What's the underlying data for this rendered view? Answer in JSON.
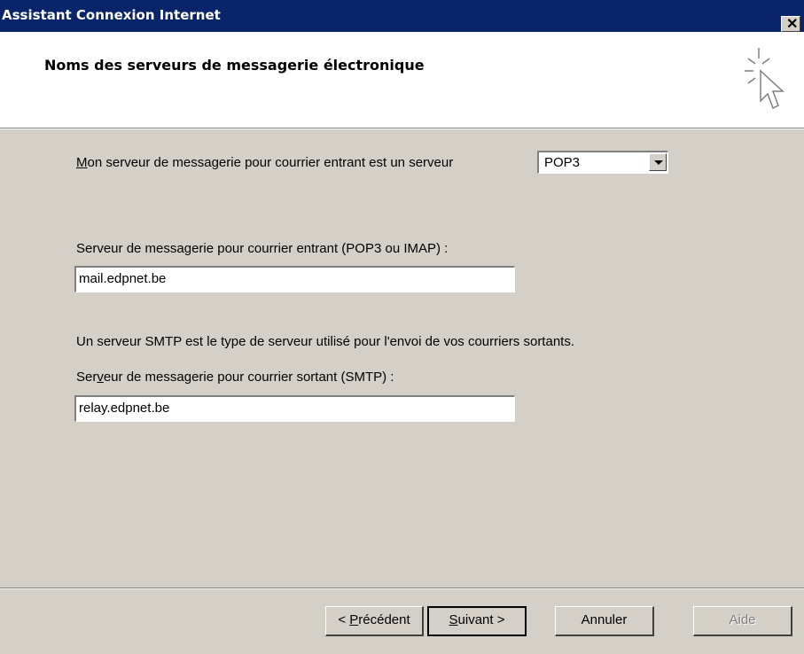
{
  "window": {
    "title": "Assistant Connexion Internet",
    "close": "✕"
  },
  "header": {
    "title": "Noms des serveurs de messagerie électronique"
  },
  "incoming_type": {
    "label_accel": "M",
    "label_rest": "on serveur de messagerie pour courrier entrant est un serveur",
    "selected": "POP3"
  },
  "incoming_server": {
    "label": "Serveur de messagerie pour courrier entrant (POP3 ou IMAP) :",
    "value": "mail.edpnet.be"
  },
  "smtp_info": "Un serveur SMTP est le type de serveur utilisé pour l'envoi de vos courriers sortants.",
  "outgoing_server": {
    "label_pre": "Ser",
    "label_accel": "v",
    "label_post": "eur de messagerie pour courrier sortant (SMTP) :",
    "value": "relay.edpnet.be"
  },
  "buttons": {
    "back_pre": "< ",
    "back_accel": "P",
    "back_post": "récédent",
    "next_accel": "S",
    "next_post": "uivant >",
    "cancel": "Annuler",
    "help": "Aide"
  }
}
